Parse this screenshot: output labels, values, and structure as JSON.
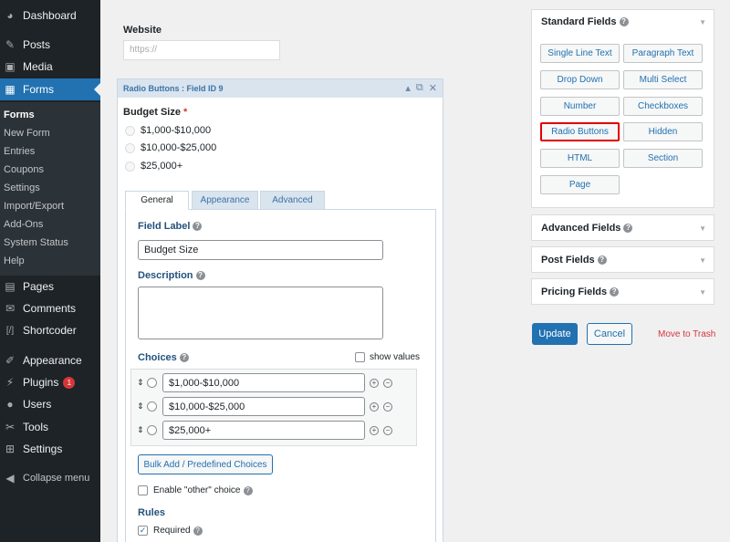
{
  "sidebar": {
    "items": [
      {
        "label": "Dashboard",
        "icon": "dashboard-icon",
        "glyph": "◕"
      },
      {
        "label": "Posts",
        "icon": "pin-icon",
        "glyph": "✎"
      },
      {
        "label": "Media",
        "icon": "media-icon",
        "glyph": "▣"
      },
      {
        "label": "Forms",
        "icon": "forms-icon",
        "glyph": "▦"
      },
      {
        "label": "Pages",
        "icon": "pages-icon",
        "glyph": "▤"
      },
      {
        "label": "Comments",
        "icon": "comments-icon",
        "glyph": "✉"
      },
      {
        "label": "Shortcoder",
        "icon": "shortcode-icon",
        "glyph": "[/]"
      },
      {
        "label": "Appearance",
        "icon": "brush-icon",
        "glyph": "✐"
      },
      {
        "label": "Plugins",
        "icon": "plugins-icon",
        "glyph": "⚡",
        "badge": "1"
      },
      {
        "label": "Users",
        "icon": "users-icon",
        "glyph": "●"
      },
      {
        "label": "Tools",
        "icon": "tools-icon",
        "glyph": "✂"
      },
      {
        "label": "Settings",
        "icon": "settings-icon",
        "glyph": "⊞"
      },
      {
        "label": "Collapse menu",
        "icon": "collapse-icon",
        "glyph": "◀"
      }
    ],
    "submenu": [
      "Forms",
      "New Form",
      "Entries",
      "Coupons",
      "Settings",
      "Import/Export",
      "Add-Ons",
      "System Status",
      "Help"
    ]
  },
  "website": {
    "label": "Website",
    "placeholder": "https://"
  },
  "field": {
    "bar_title": "Radio Buttons : Field ID 9",
    "title": "Budget Size",
    "required_mark": "*",
    "preview_choices": [
      "$1,000-$10,000",
      "$10,000-$25,000",
      "$25,000+"
    ],
    "tabs": [
      "General",
      "Appearance",
      "Advanced"
    ],
    "field_label_heading": "Field Label",
    "field_label_value": "Budget Size",
    "description_heading": "Description",
    "choices_heading": "Choices",
    "show_values": "show values",
    "choices": [
      "$1,000-$10,000",
      "$10,000-$25,000",
      "$25,000+"
    ],
    "bulk_add": "Bulk Add / Predefined Choices",
    "enable_other": "Enable \"other\" choice",
    "rules_heading": "Rules",
    "required_label": "Required"
  },
  "right_panel": {
    "standard_fields": "Standard Fields",
    "buttons": [
      "Single Line Text",
      "Paragraph Text",
      "Drop Down",
      "Multi Select",
      "Number",
      "Checkboxes",
      "Radio Buttons",
      "Hidden",
      "HTML",
      "Section",
      "Page"
    ],
    "advanced_fields": "Advanced Fields",
    "post_fields": "Post Fields",
    "pricing_fields": "Pricing Fields",
    "update": "Update",
    "cancel": "Cancel",
    "trash": "Move to Trash"
  }
}
